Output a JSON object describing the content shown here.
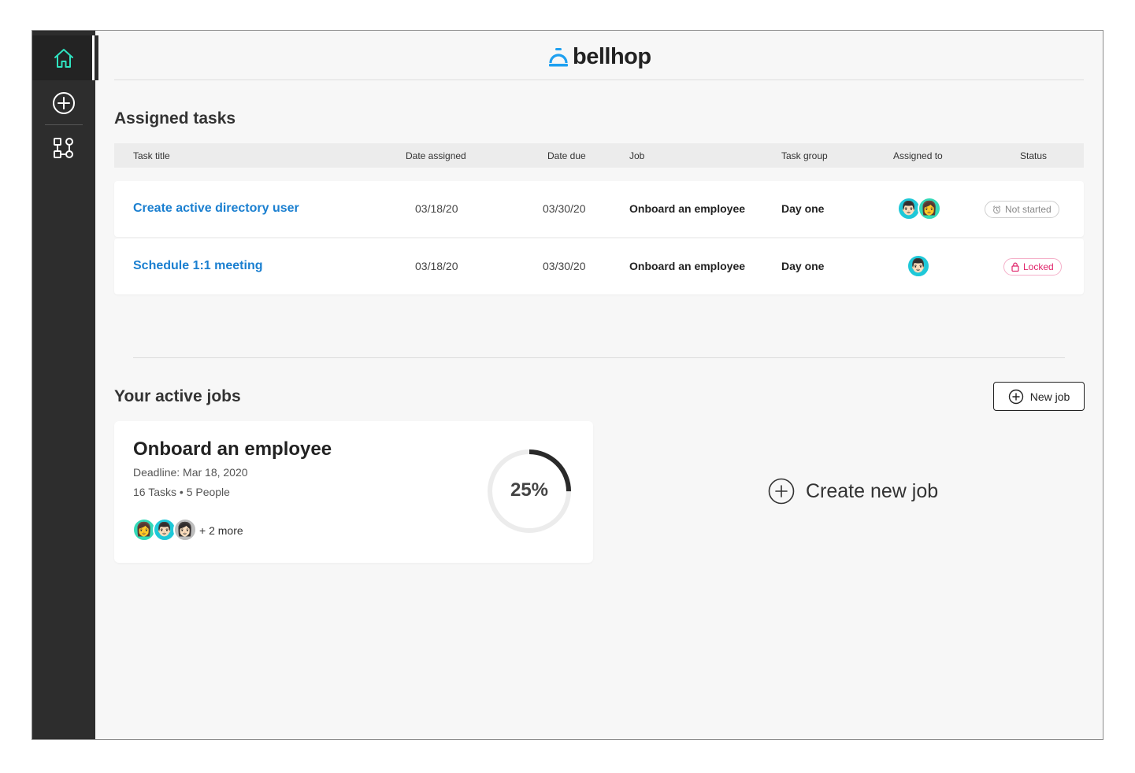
{
  "brand": {
    "name": "bellhop",
    "accent": "#1ea0f0"
  },
  "sidebar": {
    "items": [
      {
        "icon": "home-icon",
        "active": true,
        "color": "#2fe3c0"
      },
      {
        "icon": "plus-circle-icon",
        "active": false
      },
      {
        "icon": "workflow-icon",
        "active": false
      }
    ]
  },
  "tasks": {
    "title": "Assigned tasks",
    "columns": [
      "Task title",
      "Date assigned",
      "Date due",
      "Job",
      "Task group",
      "Assigned to",
      "Status"
    ],
    "rows": [
      {
        "title": "Create active directory user",
        "date_assigned": "03/18/20",
        "date_due": "03/30/20",
        "job": "Onboard an employee",
        "group": "Day one",
        "assignees": [
          "👨🏻",
          "👩"
        ],
        "status": "Not started"
      },
      {
        "title": "Schedule 1:1 meeting",
        "date_assigned": "03/18/20",
        "date_due": "03/30/20",
        "job": "Onboard an employee",
        "group": "Day one",
        "assignees": [
          "👨🏻"
        ],
        "status": "Locked"
      }
    ]
  },
  "jobs": {
    "title": "Your active jobs",
    "new_job_label": "New job",
    "card": {
      "title": "Onboard an employee",
      "deadline": "Deadline: Mar 18, 2020",
      "tasks": "16 Tasks",
      "people": "5 People",
      "avatars": [
        "👩",
        "👨🏻",
        "👩🏻"
      ],
      "more": "+ 2 more",
      "progress_label": "25%",
      "progress": 0.25
    },
    "create_label": "Create new job"
  }
}
